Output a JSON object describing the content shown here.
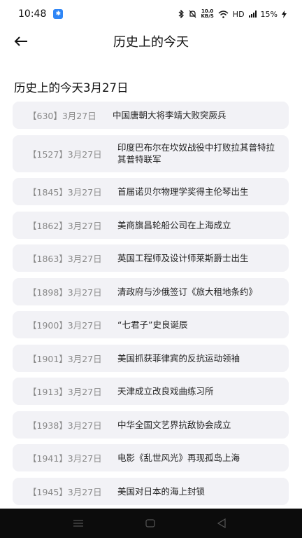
{
  "status_bar": {
    "time": "10:48",
    "net_speed_value": "10.0",
    "net_speed_unit": "KB/S",
    "hd_label": "HD",
    "battery": "15%"
  },
  "header": {
    "title": "历史上的今天"
  },
  "section": {
    "title": "历史上的今天3月27日"
  },
  "events": [
    {
      "date": "【630】3月27日",
      "text": "中国唐朝大将李靖大败突厥兵"
    },
    {
      "date": "【1527】3月27日",
      "text": "印度巴布尔在坎奴战役中打败拉其普特拉其普特联军"
    },
    {
      "date": "【1845】3月27日",
      "text": "首届诺贝尔物理学奖得主伦琴出生"
    },
    {
      "date": "【1862】3月27日",
      "text": "美商旗昌轮船公司在上海成立"
    },
    {
      "date": "【1863】3月27日",
      "text": "英国工程师及设计师莱斯爵士出生"
    },
    {
      "date": "【1898】3月27日",
      "text": "清政府与沙俄签订《旅大租地条约》"
    },
    {
      "date": "【1900】3月27日",
      "text": "“七君子”史良诞辰"
    },
    {
      "date": "【1901】3月27日",
      "text": "美国抓获菲律宾的反抗运动领袖"
    },
    {
      "date": "【1913】3月27日",
      "text": "天津成立改良戏曲练习所"
    },
    {
      "date": "【1938】3月27日",
      "text": "中华全国文艺界抗敌协会成立"
    },
    {
      "date": "【1941】3月27日",
      "text": "电影《乱世风光》再现孤岛上海"
    },
    {
      "date": "【1945】3月27日",
      "text": "美国对日本的海上封锁"
    }
  ],
  "icons": {
    "back": "arrow-left-icon",
    "bluetooth": "bluetooth-icon",
    "mute": "bell-off-icon",
    "wifi": "wifi-icon",
    "signal": "signal-icon",
    "charging": "lightning-icon",
    "nav_menu": "menu-icon",
    "nav_home": "home-square-icon",
    "nav_back": "back-triangle-icon"
  },
  "colors": {
    "card_bg": "#f2f2f6",
    "date_text": "#8a8a8a",
    "nav_bar_bg": "#0c0c0c",
    "badge": "#2f86f6"
  }
}
